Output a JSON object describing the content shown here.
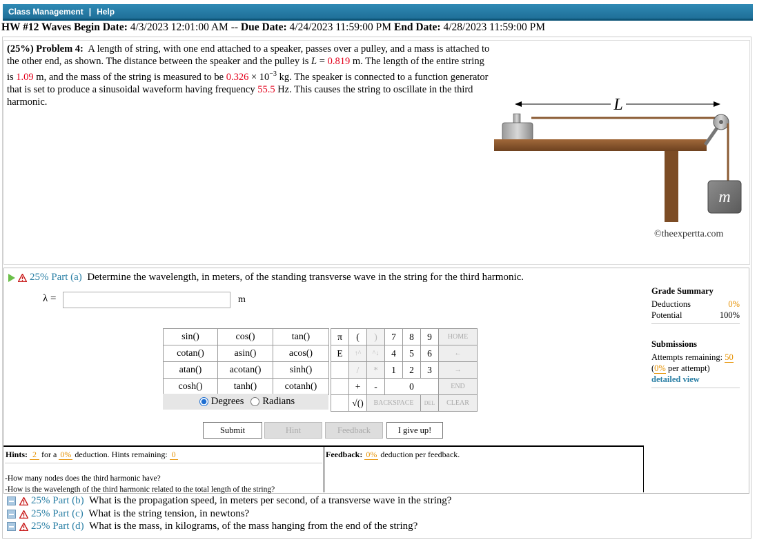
{
  "menu": {
    "items": [
      "Class Management",
      "Help"
    ],
    "separator": "|"
  },
  "hw": {
    "title": "HW #12 Waves",
    "begin_label": "Begin Date:",
    "begin": "4/3/2023 12:01:00 AM",
    "dash": "--",
    "due_label": "Due Date:",
    "due": "4/24/2023 11:59:00 PM",
    "end_label": "End Date:",
    "end": "4/28/2023 11:59:00 PM"
  },
  "problem": {
    "header": "(25%) Problem 4:",
    "t1": "A length of string, with one end attached to a speaker, passes over a pulley, and a mass is attached to the other end, as shown. The distance between the speaker and the pulley is ",
    "L_sym": "L",
    "eq": " = ",
    "L_val": "0.819",
    "t2": " m. The length of the entire string is ",
    "len_val": "1.09",
    "t3": " m, and the mass of the string is measured to be ",
    "mass_val": "0.326",
    "times_ten": " × 10",
    "exp": "−3",
    "t4": " kg. The speaker is connected to a function generator that is set to produce a sinusoidal waveform having frequency ",
    "freq_val": "55.5",
    "t5": " Hz. This causes the string to oscillate in the third harmonic.",
    "figure": {
      "L_label": "L",
      "mass_label": "m",
      "copyright": "©theexpertta.com"
    }
  },
  "part_a": {
    "percent": "25% Part (a)",
    "question": "Determine the wavelength, in meters, of the standing transverse wave in the string for the third harmonic.",
    "var": "λ =",
    "value": "",
    "unit": "m"
  },
  "grade": {
    "title": "Grade Summary",
    "deductions_label": "Deductions",
    "deductions": "0%",
    "potential_label": "Potential",
    "potential": "100%",
    "submissions_title": "Submissions",
    "attempts_label": "Attempts remaining:",
    "attempts": "50",
    "per_attempt_pct": "0%",
    "per_attempt": "per attempt)",
    "detailed": "detailed view"
  },
  "calc": {
    "functions": [
      [
        "sin()",
        "cos()",
        "tan()"
      ],
      [
        "cotan()",
        "asin()",
        "acos()"
      ],
      [
        "atan()",
        "acotan()",
        "sinh()"
      ],
      [
        "cosh()",
        "tanh()",
        "cotanh()"
      ]
    ],
    "degrees": "Degrees",
    "radians": "Radians",
    "keys": {
      "pi": "π",
      "lparen": "(",
      "rparen": ")",
      "k7": "7",
      "k8": "8",
      "k9": "9",
      "home": "HOME",
      "e": "E",
      "up": "↑^",
      "down": "^↓",
      "k4": "4",
      "k5": "5",
      "k6": "6",
      "left": "←",
      "div": "/",
      "mul": "*",
      "k1": "1",
      "k2": "2",
      "k3": "3",
      "right": "→",
      "plus": "+",
      "minus": "-",
      "k0": "0",
      "endk": "END",
      "sqrt": "√()",
      "backspace": "BACKSPACE",
      "del": "DEL",
      "clear": "CLEAR"
    }
  },
  "buttons": {
    "submit": "Submit",
    "hint": "Hint",
    "feedback": "Feedback",
    "giveup": "I give up!"
  },
  "hints": {
    "label": "Hints:",
    "count": "2",
    "for_a": "for a",
    "pct": "0%",
    "ded": "deduction. Hints remaining:",
    "remaining": "0",
    "h1": "-How many nodes does the third harmonic have?",
    "h2": "-How is the wavelength of the third harmonic related to the total length of the string?"
  },
  "feedback": {
    "label": "Feedback:",
    "pct": "0%",
    "text": "deduction per feedback."
  },
  "other_parts": [
    {
      "percent": "25% Part (b)",
      "question": "What is the propagation speed, in meters per second, of a transverse wave in the string?"
    },
    {
      "percent": "25% Part (c)",
      "question": "What is the string tension, in newtons?"
    },
    {
      "percent": "25% Part (d)",
      "question": "What is the mass, in kilograms, of the mass hanging from the end of the string?"
    }
  ],
  "colors": {
    "value_red": "#e3001b",
    "link_teal": "#2a7fa5",
    "orange": "#e69100",
    "menu_blue": "#2f8ab5"
  }
}
